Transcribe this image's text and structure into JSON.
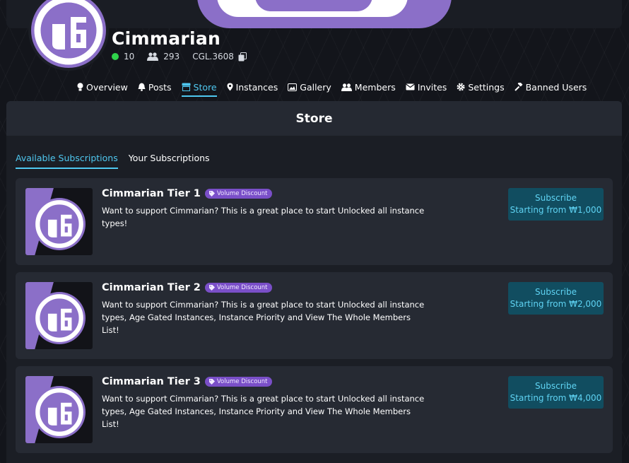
{
  "group": {
    "name": "Cimmarian",
    "online_count": "10",
    "member_count": "293",
    "code": "CGL.3608"
  },
  "nav": {
    "items": [
      {
        "label": "Overview",
        "icon": "bulb-icon"
      },
      {
        "label": "Posts",
        "icon": "bell-icon"
      },
      {
        "label": "Store",
        "icon": "store-icon"
      },
      {
        "label": "Instances",
        "icon": "location-pin-icon"
      },
      {
        "label": "Gallery",
        "icon": "image-icon"
      },
      {
        "label": "Members",
        "icon": "users-icon"
      },
      {
        "label": "Invites",
        "icon": "envelope-icon"
      },
      {
        "label": "Settings",
        "icon": "gear-icon"
      },
      {
        "label": "Banned Users",
        "icon": "gavel-icon"
      }
    ],
    "active": "Store"
  },
  "store": {
    "title": "Store",
    "tabs": [
      {
        "label": "Available Subscriptions",
        "active": true
      },
      {
        "label": "Your Subscriptions",
        "active": false
      }
    ],
    "subscriptions": [
      {
        "name": "Cimmarian Tier 1",
        "badge": "Volume Discount",
        "description": "Want to support Cimmarian? This is a great place to start Unlocked all instance types!",
        "button_line1": "Subscribe",
        "button_line2": "Starting from ₩1,000"
      },
      {
        "name": "Cimmarian Tier 2",
        "badge": "Volume Discount",
        "description": "Want to support Cimmarian? This is a great place to start Unlocked all instance types, Age Gated Instances, Instance Priority and View The Whole Members List!",
        "button_line1": "Subscribe",
        "button_line2": "Starting from ₩2,000"
      },
      {
        "name": "Cimmarian Tier 3",
        "badge": "Volume Discount",
        "description": "Want to support Cimmarian? This is a great place to start Unlocked all instance types, Age Gated Instances, Instance Priority and View The Whole Members List!",
        "button_line1": "Subscribe",
        "button_line2": "Starting from ₩4,000"
      }
    ]
  },
  "colors": {
    "accent": "#4fc8f0",
    "brand_purple": "#8b6fc8",
    "online_green": "#2fd34b",
    "badge_purple": "#7a4fc8",
    "button_bg": "#114d60"
  }
}
